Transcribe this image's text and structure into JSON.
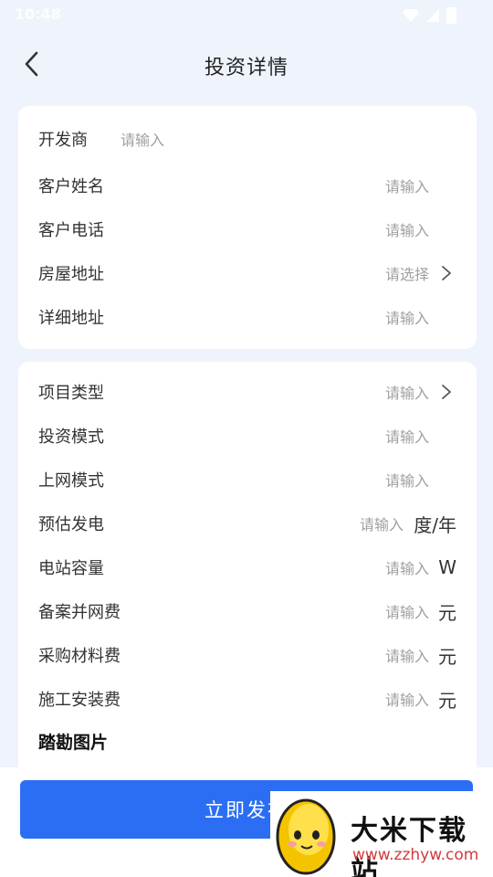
{
  "status_bar": {
    "time": "10:48"
  },
  "header": {
    "title": "投资详情"
  },
  "card1": {
    "rows": [
      {
        "label": "开发商",
        "value": "请输入"
      },
      {
        "label": "客户姓名",
        "value": "请输入"
      },
      {
        "label": "客户电话",
        "value": "请输入"
      },
      {
        "label": "房屋地址",
        "value": "请选择"
      },
      {
        "label": "详细地址",
        "value": "请输入"
      }
    ]
  },
  "card2": {
    "rows": [
      {
        "label": "项目类型",
        "value": "请输入"
      },
      {
        "label": "投资模式",
        "value": "请输入"
      },
      {
        "label": "上网模式",
        "value": "请输入"
      },
      {
        "label": "预估发电",
        "value": "请输入",
        "unit": "度/年"
      },
      {
        "label": "电站容量",
        "value": "请输入",
        "unit": "W"
      },
      {
        "label": "备案并网费",
        "value": "请输入",
        "unit": "元"
      },
      {
        "label": "采购材料费",
        "value": "请输入",
        "unit": "元"
      },
      {
        "label": "施工安装费",
        "value": "请输入",
        "unit": "元"
      }
    ],
    "section_title": "踏勘图片"
  },
  "footer": {
    "publish_label": "立即发布"
  },
  "watermark": {
    "title": "大米下载站",
    "url": "www.zzhyw.com"
  },
  "colors": {
    "background": "#eef3fc",
    "primary": "#2b6ef4",
    "placeholder": "#a0a0a0"
  }
}
